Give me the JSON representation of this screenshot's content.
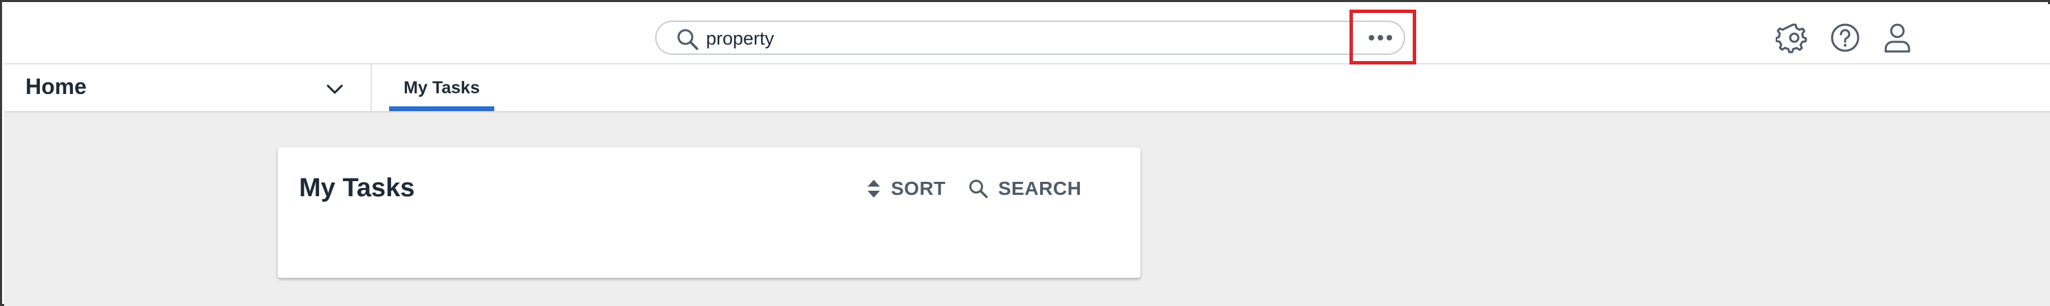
{
  "search": {
    "value": "property",
    "icon": "search-icon",
    "more_icon": "more-horizontal-icon"
  },
  "header_icons": [
    "gear-icon",
    "help-icon",
    "user-icon"
  ],
  "nav": {
    "home_label": "Home",
    "home_dropdown_icon": "chevron-down-icon",
    "tabs": [
      {
        "label": "My Tasks",
        "active": true
      }
    ]
  },
  "card": {
    "title": "My Tasks",
    "sort_label": "SORT",
    "sort_icon": "sort-icon",
    "search_label": "SEARCH",
    "search_icon": "search-icon"
  },
  "colors": {
    "accent": "#2e6ecb",
    "highlight": "#d9262b",
    "text": "#1d2a37",
    "muted": "#4f5b69",
    "background": "#eeeeee"
  }
}
